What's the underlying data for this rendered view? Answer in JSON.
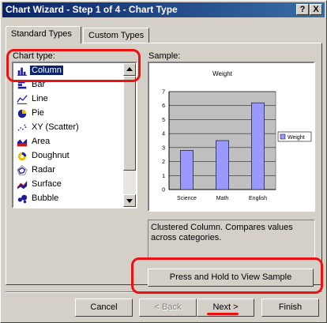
{
  "window": {
    "title": "Chart Wizard - Step 1 of 4 - Chart Type",
    "help_label": "?",
    "close_label": "X"
  },
  "tabs": [
    {
      "label": "Standard Types",
      "active": true
    },
    {
      "label": "Custom Types",
      "active": false
    }
  ],
  "chart_type_label": "Chart type:",
  "chart_types": [
    {
      "label": "Column",
      "icon": "column-chart-icon",
      "selected": true
    },
    {
      "label": "Bar",
      "icon": "bar-chart-icon"
    },
    {
      "label": "Line",
      "icon": "line-chart-icon"
    },
    {
      "label": "Pie",
      "icon": "pie-chart-icon"
    },
    {
      "label": "XY (Scatter)",
      "icon": "scatter-chart-icon"
    },
    {
      "label": "Area",
      "icon": "area-chart-icon"
    },
    {
      "label": "Doughnut",
      "icon": "doughnut-chart-icon"
    },
    {
      "label": "Radar",
      "icon": "radar-chart-icon"
    },
    {
      "label": "Surface",
      "icon": "surface-chart-icon"
    },
    {
      "label": "Bubble",
      "icon": "bubble-chart-icon"
    }
  ],
  "sample_label": "Sample:",
  "description": "Clustered Column. Compares values across categories.",
  "press_hold_label": "Press and Hold to View Sample",
  "buttons": {
    "cancel": "Cancel",
    "back": "< Back",
    "next": "Next >",
    "finish": "Finish"
  },
  "chart_data": {
    "type": "bar",
    "title": "Weight",
    "categories": [
      "Science",
      "Math",
      "English"
    ],
    "series": [
      {
        "name": "Weight",
        "values": [
          2.8,
          3.5,
          6.2
        ]
      }
    ],
    "ylim": [
      0,
      7
    ],
    "yticks": [
      "0",
      "1",
      "2",
      "3",
      "4",
      "5",
      "6",
      "7"
    ],
    "bar_color": "#9999ff",
    "plot_bg": "#c0c0c0",
    "legend": "right"
  }
}
